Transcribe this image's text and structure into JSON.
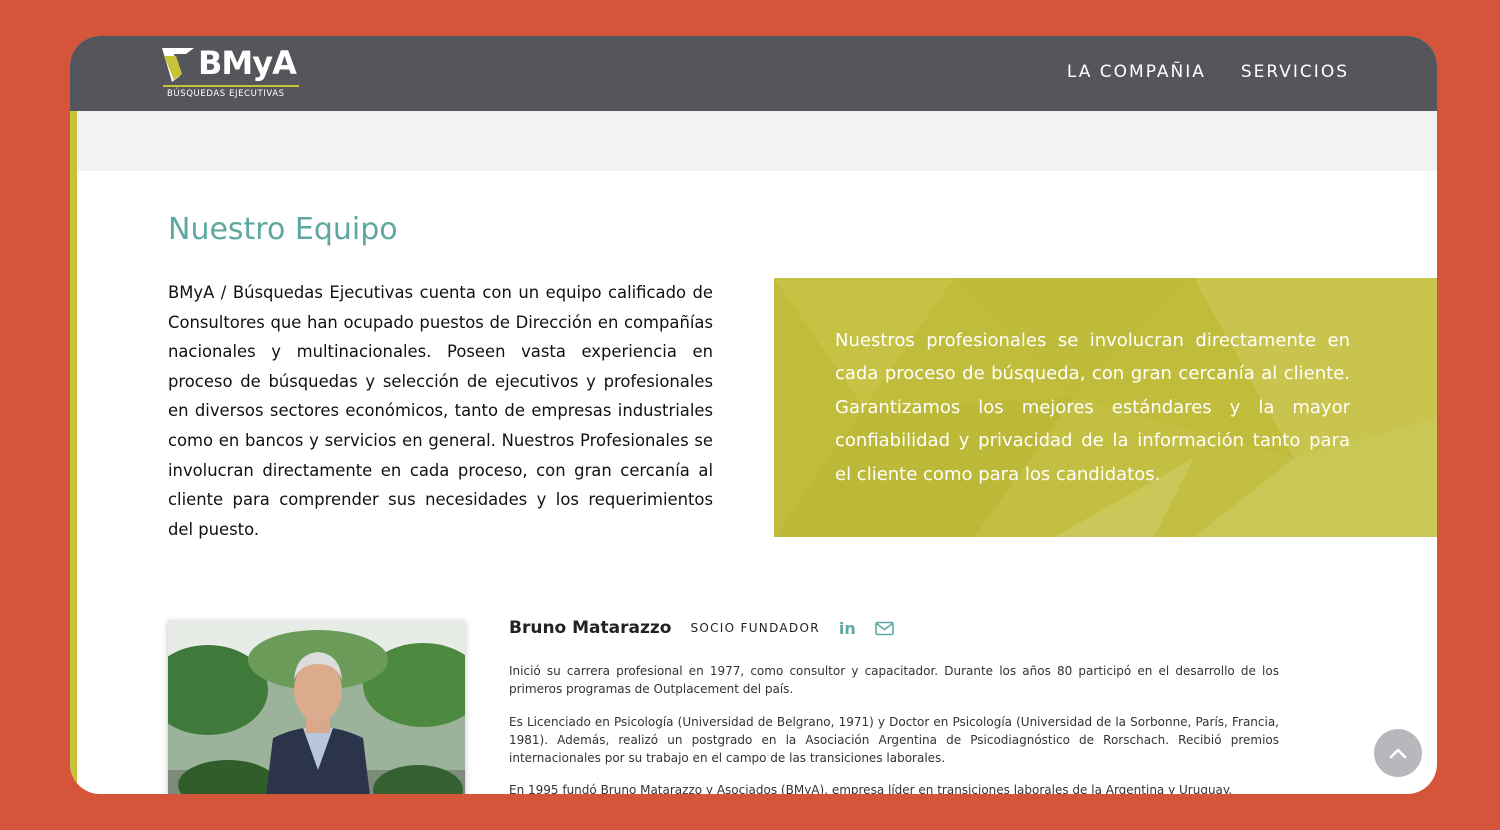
{
  "header": {
    "logo": {
      "brand": "BMyA",
      "tagline": "BÚSQUEDAS EJECUTIVAS"
    },
    "nav": [
      {
        "label": "LA COMPAÑIA"
      },
      {
        "label": "SERVICIOS"
      }
    ]
  },
  "main": {
    "title": "Nuestro Equipo",
    "intro": "BMyA / Búsquedas Ejecutivas cuenta con un equipo calificado de Consultores que han ocupado puestos de Dirección en compañías nacionales y multinacionales. Poseen vasta experiencia en proceso de búsquedas y selección de ejecutivos y profesionales en diversos sectores económicos, tanto de empresas industriales como en bancos y servicios en general. Nuestros Profesionales se involucran directamente en cada proceso, con gran cercanía al cliente para comprender sus necesidades y los requerimientos del puesto.",
    "quote": "Nuestros profesionales se involucran directamente en cada proceso de búsqueda, con gran cercanía al cliente. Garantizamos los mejores estándares y la mayor confiabilidad y privacidad de la información tanto para el cliente como para los candidatos.",
    "member": {
      "name": "Bruno Matarazzo",
      "role": "SOCIO FUNDADOR",
      "linkedin_label": "in",
      "icons": [
        "linkedin-icon",
        "mail-icon"
      ],
      "bio": [
        "Inició su carrera profesional en 1977, como consultor y capacitador. Durante los años 80 participó en el desarrollo de los primeros programas de Outplacement del país.",
        "Es Licenciado en Psicología (Universidad de Belgrano, 1971) y Doctor en Psicología (Universidad de la Sorbonne, París, Francia, 1981). Además, realizó un postgrado en la Asociación Argentina de Psicodiagnóstico de Rorschach. Recibió premios internacionales por su trabajo en el campo de las transiciones laborales.",
        "En 1995 fundó Bruno Matarazzo y Asociados (BMyA), empresa líder en transiciones laborales de la Argentina y Uruguay."
      ]
    }
  },
  "colors": {
    "background": "#d4553a",
    "navbar": "#54565b",
    "accent": "#c8c23a",
    "teal": "#5ea8a1",
    "quote_box": "#c1bd3c"
  }
}
